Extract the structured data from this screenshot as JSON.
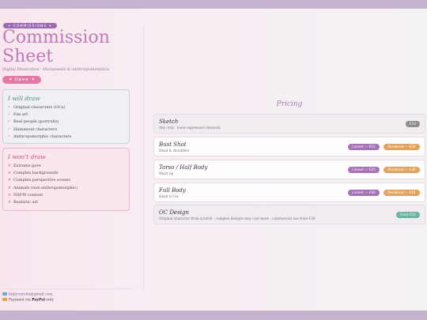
{
  "header": {
    "badge": "✦ COMMISSIONS ✦",
    "title_line1": "Commission",
    "title_line2": "Sheet",
    "subtitle": "Digital Illustration · Humanoids & Anthropomorphics",
    "status": "✦ Open ✦"
  },
  "will_draw": {
    "heading": "I will draw",
    "items": [
      "Original characters (OCs)",
      "Fan art",
      "Real people (portraits)",
      "Humanoid characters",
      "Anthropomorphic characters"
    ]
  },
  "wont_draw": {
    "heading": "I won't draw",
    "items": [
      "Extreme gore",
      "Complex backgrounds",
      "Complex perspective scenes",
      "Animals (non-anthropomorphic)",
      "NSFW content",
      "Realistic art"
    ]
  },
  "footer": {
    "email": "hi@yoursite@gmail.com",
    "payment_prefix": "Payment via",
    "payment_method": "PayPal",
    "payment_suffix": "only"
  },
  "pricing": {
    "heading": "Pricing",
    "cards": [
      {
        "title": "Sketch",
        "desc": "Any crop · loose expressive linework",
        "prices": [
          "€10"
        ]
      },
      {
        "title": "Bust Shot",
        "desc": "Head & shoulders",
        "prices": [
          "Lineart — €15",
          "Rendered — €20"
        ]
      },
      {
        "title": "Torso / Half Body",
        "desc": "Waist up",
        "prices": [
          "Lineart — €25",
          "Rendered — €30"
        ]
      },
      {
        "title": "Full Body",
        "desc": "Head to toe",
        "prices": [
          "Lineart — €40",
          "Rendered — €45"
        ]
      },
      {
        "title": "OC Design",
        "desc": "Original character from scratch · complex designs may cost more · commercial use from €30",
        "prices": [
          "From €25"
        ]
      }
    ]
  },
  "colors": {
    "bars": "#c4b3cf",
    "title": "#c07ab6",
    "accent_purple": "#9a6bb1",
    "status_pink": "#e07aa5",
    "will_green": "#4f8d78",
    "wont_pink": "#cc4f7a",
    "price_flat": "#8e8e8e",
    "price_lineart": "#a771b8",
    "price_rendered": "#e4a35c",
    "price_from": "#69b5a2"
  },
  "icons": {
    "will_bullet": "bullet-dot-icon",
    "wont_bullet": "cross-mark-icon",
    "email": "envelope-icon",
    "payment": "credit-card-icon"
  }
}
